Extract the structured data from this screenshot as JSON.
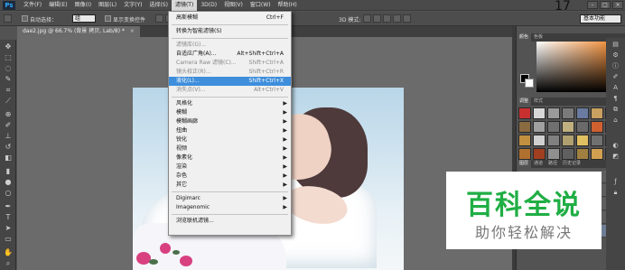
{
  "app": {
    "logo": "Ps",
    "zoom_badge": "17"
  },
  "menubar": {
    "items": [
      {
        "label": "文件(F)"
      },
      {
        "label": "编辑(E)"
      },
      {
        "label": "图像(I)"
      },
      {
        "label": "图层(L)"
      },
      {
        "label": "文字(Y)"
      },
      {
        "label": "选择(S)"
      },
      {
        "label": "滤镜(T)",
        "active": true
      },
      {
        "label": "3D(D)"
      },
      {
        "label": "视图(V)"
      },
      {
        "label": "窗口(W)"
      },
      {
        "label": "帮助(H)"
      }
    ]
  },
  "window_controls": {
    "minimize": "–",
    "maximize": "□",
    "close": "×"
  },
  "options": {
    "auto_select_label": "自动选择：",
    "auto_select_value": "组",
    "show_transform_label": "显示变换控件",
    "mode_3d_label": "3D 模式:",
    "workspace": "基本功能"
  },
  "document": {
    "tab_title": "dae2.jpg @ 66.7% (背景 拷贝, Lab/8) *",
    "close": "×"
  },
  "filter_menu": {
    "items": [
      {
        "label": "高斯模糊",
        "shortcut": "Ctrl+F"
      },
      {
        "sep": true
      },
      {
        "label": "转换为智能滤镜(S)"
      },
      {
        "sep": true
      },
      {
        "label": "滤镜库(G)...",
        "disabled": true
      },
      {
        "label": "自适应广角(A)...",
        "shortcut": "Alt+Shift+Ctrl+A"
      },
      {
        "label": "Camera Raw 滤镜(C)...",
        "shortcut": "Shift+Ctrl+A",
        "disabled": true
      },
      {
        "label": "镜头校正(R)...",
        "shortcut": "Shift+Ctrl+R",
        "disabled": true
      },
      {
        "label": "液化(L)...",
        "shortcut": "Shift+Ctrl+X",
        "highlight": true
      },
      {
        "label": "消失点(V)...",
        "shortcut": "Alt+Ctrl+V",
        "disabled": true
      },
      {
        "sep": true
      },
      {
        "label": "风格化",
        "submenu": true
      },
      {
        "label": "模糊",
        "submenu": true
      },
      {
        "label": "模糊画廊",
        "submenu": true
      },
      {
        "label": "扭曲",
        "submenu": true
      },
      {
        "label": "锐化",
        "submenu": true
      },
      {
        "label": "视频",
        "submenu": true
      },
      {
        "label": "像素化",
        "submenu": true
      },
      {
        "label": "渲染",
        "submenu": true
      },
      {
        "label": "杂色",
        "submenu": true
      },
      {
        "label": "其它",
        "submenu": true
      },
      {
        "sep": true
      },
      {
        "label": "Digimarc",
        "submenu": true
      },
      {
        "label": "Imagenomic",
        "submenu": true
      },
      {
        "sep": true
      },
      {
        "label": "浏览联机滤镜..."
      }
    ]
  },
  "panels": {
    "color_tabs": [
      {
        "label": "颜色"
      },
      {
        "label": "色板"
      }
    ],
    "adjust_tabs": [
      {
        "label": "调整"
      },
      {
        "label": "样式"
      }
    ],
    "layers_tabs": [
      {
        "label": "图层"
      },
      {
        "label": "通道"
      },
      {
        "label": "路径"
      },
      {
        "label": "历史记录"
      }
    ]
  },
  "swatch_colors": [
    "#c83030",
    "#d8d8d8",
    "#9a9a9a",
    "#7a7a7a",
    "#6a7aa0",
    "#c8a060",
    "#e05020",
    "#8a6a40",
    "#a0a0a0",
    "#707070",
    "#c0b080",
    "#6a6a6a",
    "#d06030",
    "#404040",
    "#c09040",
    "#d0d0d0",
    "#808080",
    "#b0a070",
    "#e0c060",
    "#707070",
    "#505050",
    "#b07030",
    "#a04020",
    "#909090",
    "#606060",
    "#a08040",
    "#d0a050",
    "#303030"
  ],
  "watermark": {
    "title": "百科全说",
    "subtitle": "助你轻松解决"
  }
}
